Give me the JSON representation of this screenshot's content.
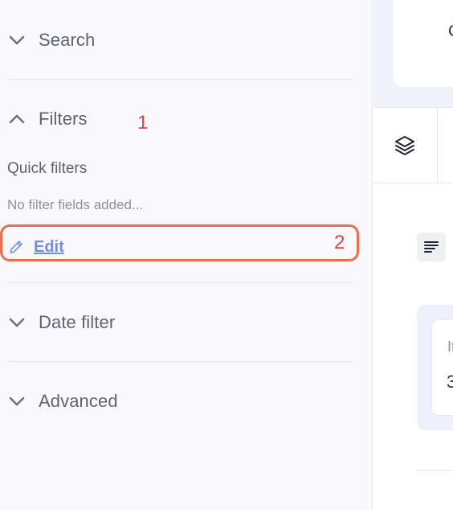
{
  "sidebar": {
    "sections": {
      "search": {
        "title": "Search",
        "expanded": false
      },
      "filters": {
        "title": "Filters",
        "expanded": true
      },
      "date_filter": {
        "title": "Date filter",
        "expanded": false
      },
      "advanced": {
        "title": "Advanced",
        "expanded": false
      }
    },
    "quick_filters": {
      "label": "Quick filters",
      "empty_text": "No filter fields added...",
      "edit_label": "Edit"
    }
  },
  "annotations": {
    "marker_1": "1",
    "marker_2": "2",
    "highlight_color": "#ee6e4c",
    "marker_color": "#e8433a"
  },
  "main": {
    "top_card_text": "C",
    "stat_card": {
      "label": "It",
      "value": "3"
    }
  },
  "icons": {
    "collapsed": "chevron-down-icon",
    "expanded": "chevron-up-icon",
    "edit": "pencil-icon",
    "layers": "layers-icon",
    "sort": "sort-lines-icon"
  },
  "colors": {
    "sidebar_bg": "#f9f9fd",
    "text": "#5b6474",
    "link": "#6b8ef0"
  }
}
